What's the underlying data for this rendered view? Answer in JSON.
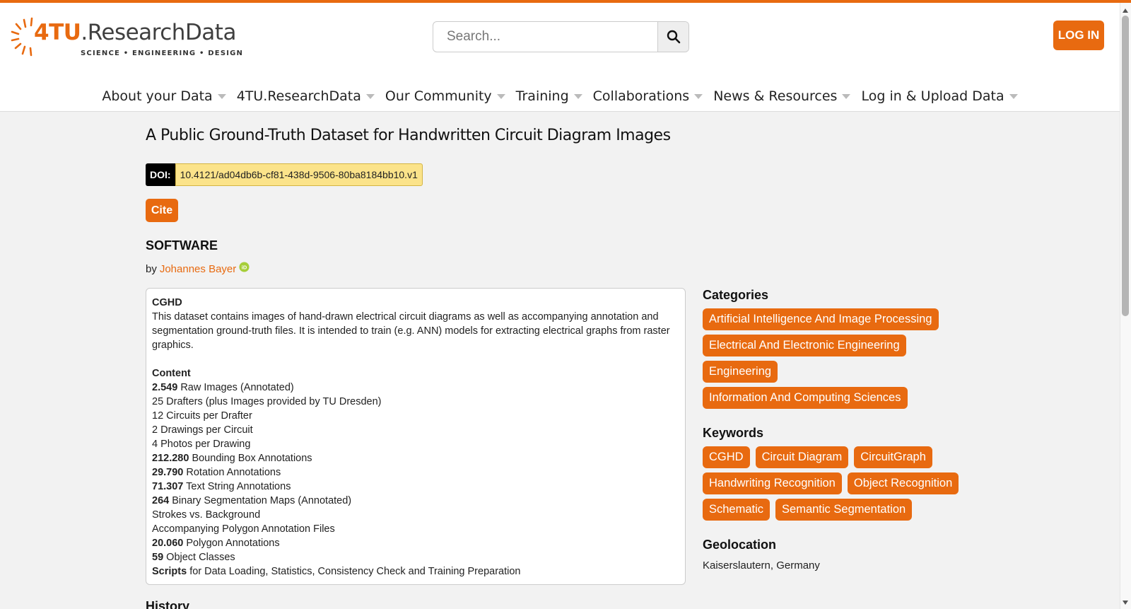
{
  "colors": {
    "accent": "#e86a10",
    "doi_bg": "#fbe38a",
    "orcid": "#a6ce39"
  },
  "header": {
    "logo": {
      "name_bold": "4TU",
      "name_rest": ".ResearchData",
      "tagline": "SCIENCE • ENGINEERING • DESIGN"
    },
    "search": {
      "placeholder": "Search..."
    },
    "login_label": "LOG IN"
  },
  "nav": {
    "items": [
      {
        "label": "About your Data"
      },
      {
        "label": "4TU.ResearchData"
      },
      {
        "label": "Our Community"
      },
      {
        "label": "Training"
      },
      {
        "label": "Collaborations"
      },
      {
        "label": "News & Resources"
      },
      {
        "label": "Log in & Upload Data"
      }
    ]
  },
  "dataset": {
    "title": "A Public Ground-Truth Dataset for Handwritten Circuit Diagram Images",
    "doi_label": "DOI:",
    "doi_value": "10.4121/ad04db6b-cf81-438d-9506-80ba8184bb10.v1",
    "cite_label": "Cite",
    "type": "SOFTWARE",
    "by_label": "by",
    "author": "Johannes Bayer"
  },
  "description": {
    "heading": "CGHD",
    "intro": "This dataset contains images of hand-drawn electrical circuit diagrams as well as accompanying annotation and segmentation ground-truth files. It is intended to train (e.g. ANN) models for extracting electrical graphs from raster graphics.",
    "content_heading": "Content",
    "lines": [
      {
        "bold": "2.549",
        "text": " Raw Images (Annotated)"
      },
      {
        "bold": "",
        "text": "25 Drafters (plus Images provided by TU Dresden)"
      },
      {
        "bold": "",
        "text": "12 Circuits per Drafter"
      },
      {
        "bold": "",
        "text": "2 Drawings per Circuit"
      },
      {
        "bold": "",
        "text": "4 Photos per Drawing"
      },
      {
        "bold": "212.280",
        "text": " Bounding Box Annotations"
      },
      {
        "bold": "29.790",
        "text": " Rotation Annotations"
      },
      {
        "bold": "71.307",
        "text": " Text String Annotations"
      },
      {
        "bold": "264",
        "text": " Binary Segmentation Maps (Annotated)"
      },
      {
        "bold": "",
        "text": "Strokes vs. Background"
      },
      {
        "bold": "",
        "text": "Accompanying Polygon Annotation Files"
      },
      {
        "bold": "20.060",
        "text": " Polygon Annotations"
      },
      {
        "bold": "59",
        "text": " Object Classes"
      },
      {
        "bold": "Scripts",
        "text": " for Data Loading, Statistics, Consistency Check and Training Preparation"
      }
    ]
  },
  "history_heading": "History",
  "sidebar": {
    "categories_heading": "Categories",
    "categories": [
      "Artificial Intelligence And Image Processing",
      "Electrical And Electronic Engineering",
      "Engineering",
      "Information And Computing Sciences"
    ],
    "keywords_heading": "Keywords",
    "keywords": [
      "CGHD",
      "Circuit Diagram",
      "CircuitGraph",
      "Handwriting Recognition",
      "Object Recognition",
      "Schematic",
      "Semantic Segmentation"
    ],
    "geolocation_heading": "Geolocation",
    "geolocation": "Kaiserslautern, Germany"
  },
  "icons": {
    "search": "search-icon",
    "orcid": "orcid-icon",
    "caret": "caret-down-icon"
  }
}
